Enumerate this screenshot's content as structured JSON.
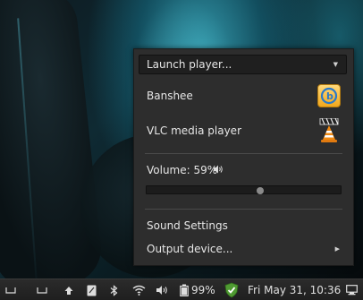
{
  "menu": {
    "launch_player": "Launch player...",
    "players": [
      {
        "name": "Banshee",
        "icon": "banshee-icon"
      },
      {
        "name": "VLC media player",
        "icon": "vlc-cone-icon"
      }
    ],
    "volume_label": "Volume: 59%",
    "volume_level": 0.59,
    "sound_settings": "Sound Settings",
    "output_device": "Output device..."
  },
  "panel": {
    "battery": "99%",
    "clock": "Fri May 31, 10:36",
    "tray_icons": [
      "show-desktop-icon",
      "upload-icon",
      "notes-icon",
      "bluetooth-icon",
      "wifi-icon",
      "volume-icon",
      "battery-icon",
      "shield-icon",
      "workspace-icon"
    ]
  },
  "colors": {
    "menu_bg": "#2d2d2d",
    "panel_bg": "#242424",
    "text": "#e6e6e6",
    "accent_green": "#5ea33a"
  }
}
